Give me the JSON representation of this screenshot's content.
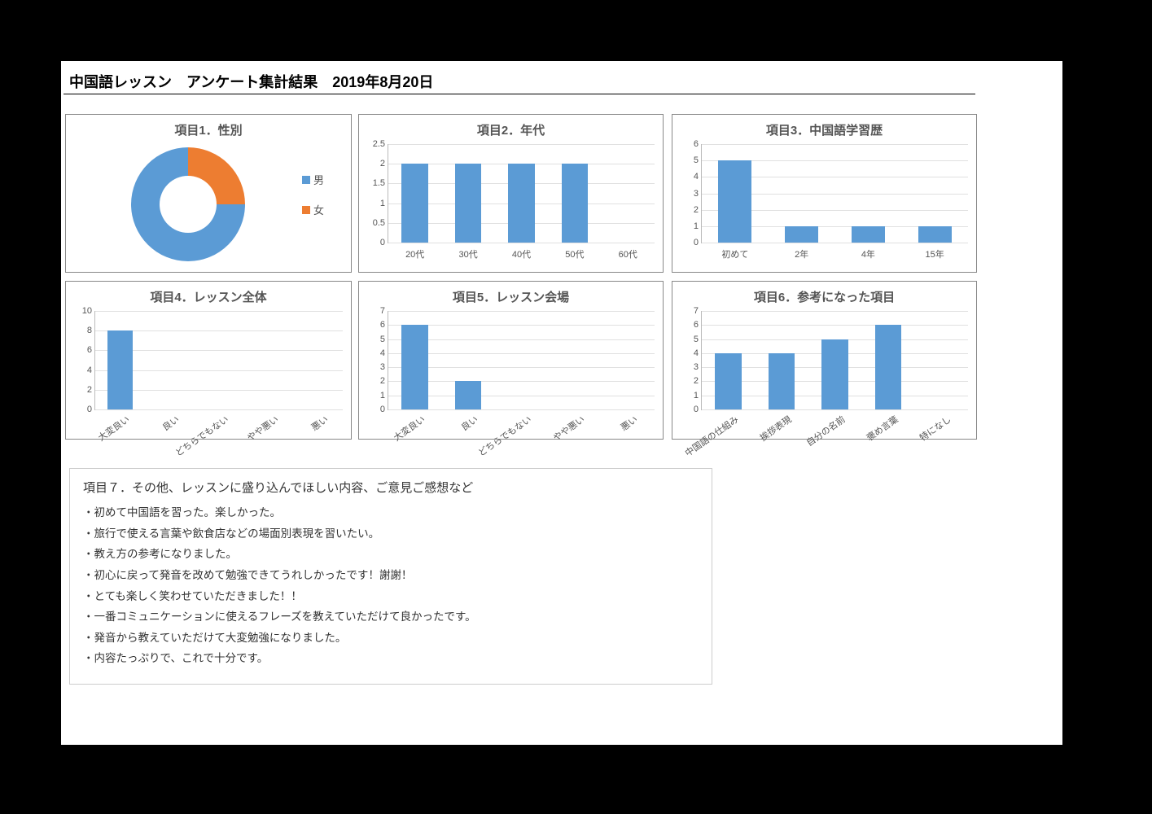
{
  "page_title": "中国語レッスン　アンケート集計結果　2019年8月20日",
  "legend": {
    "male": "男",
    "female": "女"
  },
  "chart_data": [
    {
      "id": "c1",
      "type": "pie",
      "title": "項目1．性別",
      "categories": [
        "男",
        "女"
      ],
      "values": [
        6,
        2
      ],
      "colors": [
        "#5B9BD5",
        "#ED7D31"
      ]
    },
    {
      "id": "c2",
      "type": "bar",
      "title": "項目2．年代",
      "categories": [
        "20代",
        "30代",
        "40代",
        "50代",
        "60代"
      ],
      "values": [
        2,
        2,
        2,
        2,
        0
      ],
      "ylim": [
        0,
        2.5
      ],
      "yticks": [
        0,
        0.5,
        1,
        1.5,
        2,
        2.5
      ]
    },
    {
      "id": "c3",
      "type": "bar",
      "title": "項目3．中国語学習歴",
      "categories": [
        "初めて",
        "2年",
        "4年",
        "15年"
      ],
      "values": [
        5,
        1,
        1,
        1
      ],
      "ylim": [
        0,
        6
      ],
      "yticks": [
        0,
        1,
        2,
        3,
        4,
        5,
        6
      ]
    },
    {
      "id": "c4",
      "type": "bar",
      "title": "項目4．レッスン全体",
      "categories": [
        "大変良い",
        "良い",
        "どちらでもない",
        "やや悪い",
        "悪い"
      ],
      "values": [
        8,
        0,
        0,
        0,
        0
      ],
      "ylim": [
        0,
        10
      ],
      "yticks": [
        0,
        2,
        4,
        6,
        8,
        10
      ],
      "rot": true
    },
    {
      "id": "c5",
      "type": "bar",
      "title": "項目5．レッスン会場",
      "categories": [
        "大変良い",
        "良い",
        "どちらでもない",
        "やや悪い",
        "悪い"
      ],
      "values": [
        6,
        2,
        0,
        0,
        0
      ],
      "ylim": [
        0,
        7
      ],
      "yticks": [
        0,
        1,
        2,
        3,
        4,
        5,
        6,
        7
      ],
      "rot": true
    },
    {
      "id": "c6",
      "type": "bar",
      "title": "項目6．参考になった項目",
      "categories": [
        "中国語の仕組み",
        "挨拶表現",
        "自分の名前",
        "褒め言葉",
        "特になし"
      ],
      "values": [
        4,
        4,
        5,
        6,
        0
      ],
      "ylim": [
        0,
        7
      ],
      "yticks": [
        0,
        1,
        2,
        3,
        4,
        5,
        6,
        7
      ],
      "rot": true
    }
  ],
  "comments": {
    "title": "項目７．その他、レッスンに盛り込んでほしい内容、ご意見ご感想など",
    "lines": [
      "・初めて中国語を習った。楽しかった。",
      "・旅行で使える言葉や飲食店などの場面別表現を習いたい。",
      "・教え方の参考になりました。",
      "・初心に戻って発音を改めて勉強できてうれしかったです！謝謝！",
      "・とても楽しく笑わせていただきました！！",
      "・一番コミュニケーションに使えるフレーズを教えていただけて良かったです。",
      "・発音から教えていただけて大変勉強になりました。",
      "・内容たっぷりで、これで十分です。"
    ]
  }
}
